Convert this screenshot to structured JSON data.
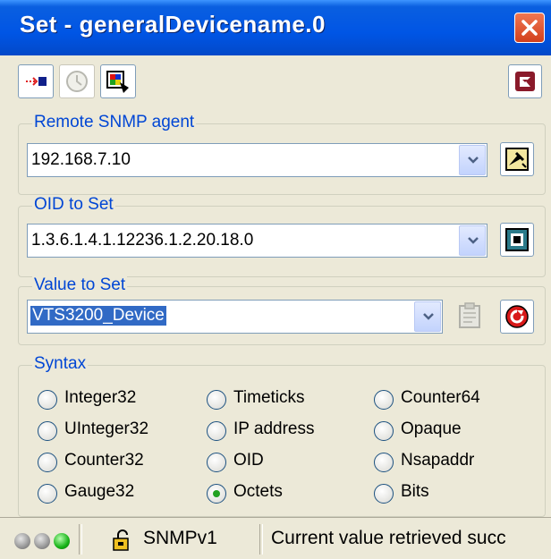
{
  "window": {
    "title": "Set - generalDevicename.0"
  },
  "toolbar": {
    "buttons": [
      {
        "name": "send-set-icon",
        "enabled": true
      },
      {
        "name": "clock-icon",
        "enabled": false
      },
      {
        "name": "palette-icon",
        "enabled": true
      }
    ],
    "right_button": "exit-icon"
  },
  "remote_agent": {
    "label": "Remote SNMP agent",
    "value": "192.168.7.10"
  },
  "oid": {
    "label": "OID to Set",
    "value": "1.3.6.1.4.1.12236.1.2.20.18.0"
  },
  "value_to_set": {
    "label": "Value to Set",
    "value": "VTS3200_Device"
  },
  "syntax": {
    "label": "Syntax",
    "options": [
      {
        "label": "Integer32",
        "selected": false
      },
      {
        "label": "UInteger32",
        "selected": false
      },
      {
        "label": "Counter32",
        "selected": false
      },
      {
        "label": "Gauge32",
        "selected": false
      },
      {
        "label": "Timeticks",
        "selected": false
      },
      {
        "label": "IP address",
        "selected": false
      },
      {
        "label": "OID",
        "selected": false
      },
      {
        "label": "Octets",
        "selected": true
      },
      {
        "label": "Counter64",
        "selected": false
      },
      {
        "label": "Opaque",
        "selected": false
      },
      {
        "label": "Nsapaddr",
        "selected": false
      },
      {
        "label": "Bits",
        "selected": false
      }
    ],
    "selected_color": "#21a121"
  },
  "status": {
    "version": "SNMPv1",
    "message": "Current value retrieved succ"
  },
  "colors": {
    "title_bar": "#0055e5",
    "accent": "#0046d5",
    "window_bg": "#ece9d8",
    "selection": "#316ac5"
  }
}
